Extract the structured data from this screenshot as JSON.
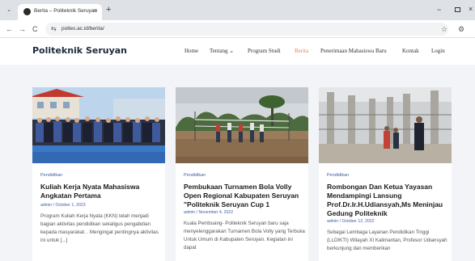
{
  "browser": {
    "tab_title": "Berita – Politeknik Seruyan",
    "tab_close": "×",
    "new_tab": "+",
    "url": "poltes.ac.id/berita/",
    "back": "←",
    "forward": "→",
    "reload": "C",
    "star": "☆",
    "window_min": "−",
    "window_close": "×",
    "extension": "⚙"
  },
  "site": {
    "logo": "Politeknik Seruyan",
    "nav": [
      {
        "label": "Home"
      },
      {
        "label": "Tentang ⌄"
      },
      {
        "label": "Program Studi"
      },
      {
        "label": "Berita"
      },
      {
        "label": "Penerimaan Mahasiswa Baru"
      },
      {
        "label": "Kontak"
      },
      {
        "label": "Login"
      }
    ],
    "active_color": "#e6835a"
  },
  "cards": [
    {
      "category": "Pendidikan",
      "title": "Kuliah Kerja Nyata Mahasiswa Angkatan Pertama",
      "meta": "admin / October 1, 2023",
      "excerpt": "Program Kuliah Kerja Nyata (KKN) telah menjadi bagian aktivitas pendidikan sekaligus pengabdian kepada masyarakat. . Mengingat pentingnya aktivitas ini untuk [...]"
    },
    {
      "category": "Pendidikan",
      "title": "Pembukaan Turnamen Bola Volly Open Regional Kabupaten Seruyan \"Politeknik Seruyan Cup 1",
      "meta": "admin / November 4, 2022",
      "excerpt": "Kuala Pembuang- Politeknik Seruyan baru saja menyelenggarakan Turnamen Bola Volly yang Terbuka Untuk Umum di Kabupaten Seruyan. Kegiatan ini dapat"
    },
    {
      "category": "Pendidikan",
      "title": "Rombongan Dan Ketua  Yayasan Mendampingi Lansung Prof.Dr.Ir.H.Udiansyah,Ms Meninjau Gedung Politeknik",
      "meta": "admin / October 12, 2022",
      "excerpt": "Sebagai Lembaga Layanan Pendidikan Tinggi (LLDIKTI) Wilayah XI Kalimantan, Profesor Udiansyah berkunjung dan memberikan"
    }
  ]
}
